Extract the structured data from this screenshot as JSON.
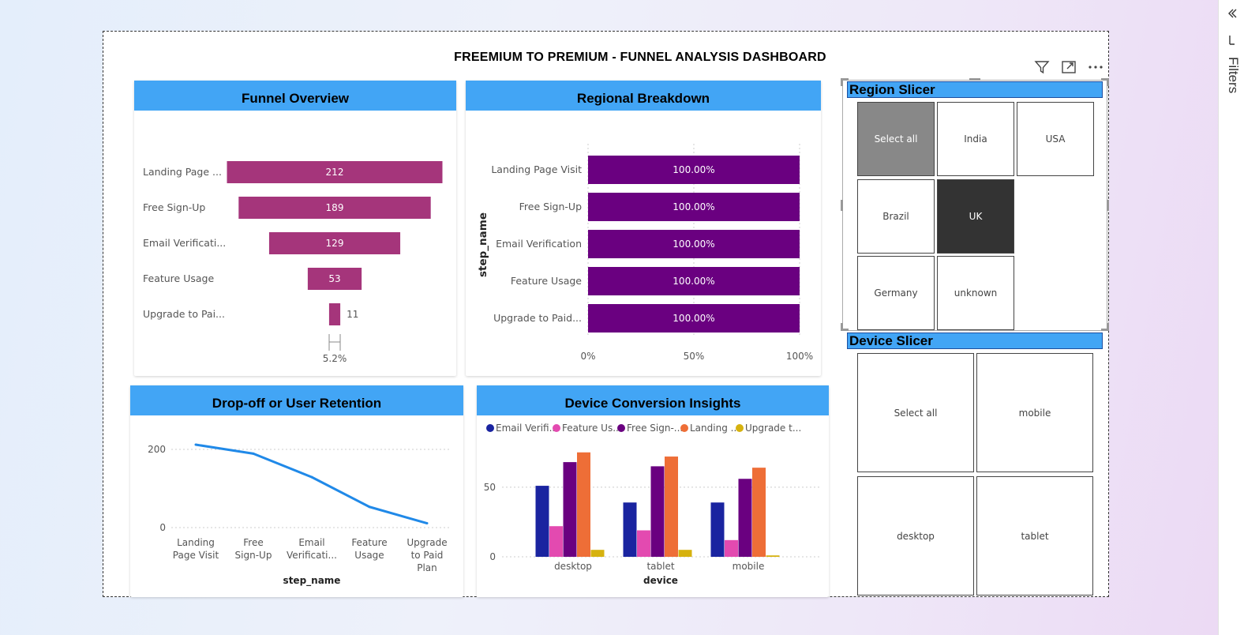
{
  "dashboard": {
    "title": "FREEMIUM TO PREMIUM - FUNNEL ANALYSIS DASHBOARD"
  },
  "toolbar": {
    "filter_icon": "filter-icon",
    "focus_icon": "focus-mode-icon",
    "more_icon": "more-options-icon"
  },
  "filters_pane": {
    "label": "Filters"
  },
  "colors": {
    "header": "#42a5f5",
    "funnel": "#a5357b",
    "purple": "#6a0080",
    "line": "#2089e8",
    "navy": "#1a24a0",
    "pink": "#e34ab0",
    "orange": "#ee6e37",
    "gold": "#d6b20f"
  },
  "funnel_card": {
    "title": "Funnel Overview",
    "conversion_label": "5.2%"
  },
  "regional_card": {
    "title": "Regional Breakdown"
  },
  "retention_card": {
    "title": "Drop-off or User Retention"
  },
  "device_card": {
    "title": "Device Conversion Insights"
  },
  "region_slicer": {
    "title": "Region Slicer",
    "items": [
      {
        "label": "Select all",
        "state": "gray"
      },
      {
        "label": "India",
        "state": ""
      },
      {
        "label": "USA",
        "state": ""
      },
      {
        "label": "Brazil",
        "state": ""
      },
      {
        "label": "UK",
        "state": "dark"
      },
      {
        "label": "Germany",
        "state": ""
      },
      {
        "label": "unknown",
        "state": ""
      }
    ]
  },
  "device_slicer": {
    "title": "Device Slicer",
    "items": [
      {
        "label": "Select all"
      },
      {
        "label": "mobile"
      },
      {
        "label": "desktop"
      },
      {
        "label": "tablet"
      }
    ]
  },
  "chart_data": [
    {
      "id": "funnel",
      "type": "bar",
      "title": "Funnel Overview",
      "categories": [
        "Landing Page ...",
        "Free Sign-Up",
        "Email Verificati...",
        "Feature Usage",
        "Upgrade to Pai..."
      ],
      "values": [
        212,
        189,
        129,
        53,
        11
      ],
      "value_labels": [
        "212",
        "189",
        "129",
        "53",
        "11"
      ]
    },
    {
      "id": "regional",
      "type": "bar",
      "title": "Regional Breakdown",
      "categories": [
        "Landing Page Visit",
        "Free Sign-Up",
        "Email Verification",
        "Feature Usage",
        "Upgrade to Paid..."
      ],
      "values": [
        100,
        100,
        100,
        100,
        100
      ],
      "value_labels": [
        "100.00%",
        "100.00%",
        "100.00%",
        "100.00%",
        "100.00%"
      ],
      "ylabel": "step_name",
      "xlim": [
        0,
        100
      ],
      "xticks": [
        0,
        50,
        100
      ],
      "xtick_labels": [
        "0%",
        "50%",
        "100%"
      ],
      "grid": true
    },
    {
      "id": "retention",
      "type": "line",
      "title": "Drop-off or User Retention",
      "categories": [
        [
          "Landing",
          "Page Visit"
        ],
        [
          "Free",
          "Sign-Up"
        ],
        [
          "Email",
          "Verificati..."
        ],
        [
          "Feature",
          "Usage"
        ],
        [
          "Upgrade",
          "to Paid",
          "Plan"
        ]
      ],
      "values": [
        212,
        189,
        129,
        53,
        11
      ],
      "xlabel": "step_name",
      "ylim": [
        0,
        212
      ],
      "yticks": [
        0,
        200
      ],
      "grid": true
    },
    {
      "id": "device",
      "type": "bar",
      "title": "Device Conversion Insights",
      "categories": [
        "desktop",
        "tablet",
        "mobile"
      ],
      "xlabel": "device",
      "ylim": [
        0,
        76
      ],
      "yticks": [
        0,
        50
      ],
      "grid": true,
      "legend": "top-left",
      "series": [
        {
          "name": "Email Verifi...",
          "values": [
            51,
            39,
            39
          ]
        },
        {
          "name": "Feature Us...",
          "values": [
            22,
            19,
            12
          ]
        },
        {
          "name": "Free Sign-...",
          "values": [
            68,
            65,
            56
          ]
        },
        {
          "name": "Landing ...",
          "values": [
            75,
            72,
            64
          ]
        },
        {
          "name": "Upgrade t...",
          "values": [
            5,
            5,
            1
          ]
        }
      ]
    }
  ]
}
